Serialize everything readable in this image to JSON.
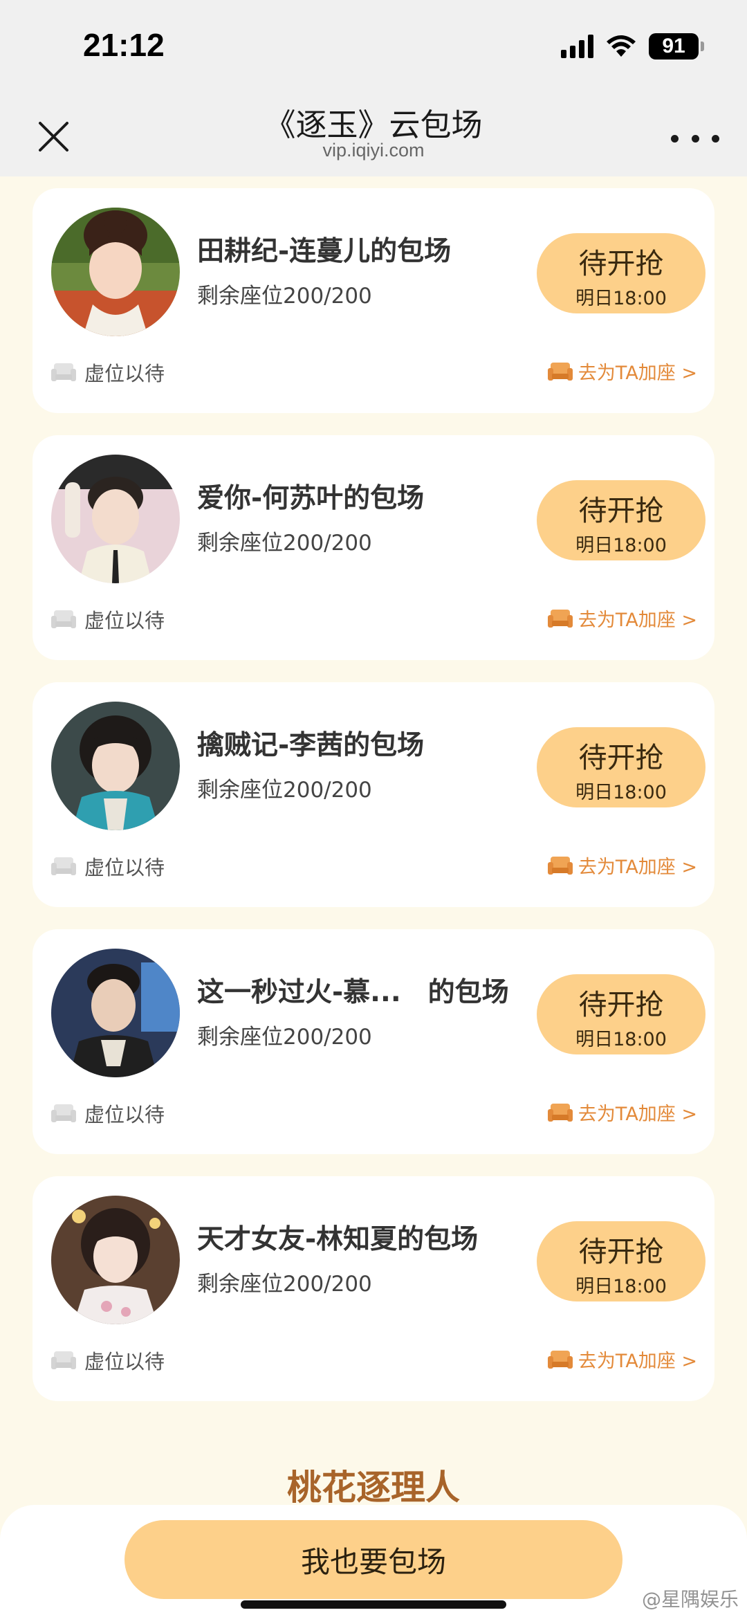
{
  "status_bar": {
    "time": "21:12",
    "battery": "91",
    "icons": [
      "signal-icon",
      "wifi-icon",
      "battery-icon"
    ]
  },
  "nav": {
    "title": "《逐玉》云包场",
    "url": "vip.iqiyi.com",
    "close_icon": "close-icon",
    "more_icon": "more-icon"
  },
  "cards": [
    {
      "title": "田耕纪-连蔓儿的包场",
      "seats": "剩余座位200/200",
      "button_label": "待开抢",
      "button_time": "明日18:00",
      "wait_text": "虚位以待",
      "add_text": "去为TA加座 >"
    },
    {
      "title": "爱你-何苏叶的包场",
      "seats": "剩余座位200/200",
      "button_label": "待开抢",
      "button_time": "明日18:00",
      "wait_text": "虚位以待",
      "add_text": "去为TA加座 >"
    },
    {
      "title": "擒贼记-李茜的包场",
      "seats": "剩余座位200/200",
      "button_label": "待开抢",
      "button_time": "明日18:00",
      "wait_text": "虚位以待",
      "add_text": "去为TA加座 >"
    },
    {
      "title": "这一秒过火-慕...　的包场",
      "seats": "剩余座位200/200",
      "button_label": "待开抢",
      "button_time": "明日18:00",
      "wait_text": "虚位以待",
      "add_text": "去为TA加座 >"
    },
    {
      "title": "天才女友-林知夏的包场",
      "seats": "剩余座位200/200",
      "button_label": "待开抢",
      "button_time": "明日18:00",
      "wait_text": "虚位以待",
      "add_text": "去为TA加座 >"
    }
  ],
  "section_title": "桃花逐理人",
  "cta_label": "我也要包场",
  "watermark": "@星隅娱乐",
  "colors": {
    "accent": "#fdd08a",
    "link": "#e38a3a",
    "section_title": "#a8642a",
    "page_bg": "#fdf9ea"
  }
}
